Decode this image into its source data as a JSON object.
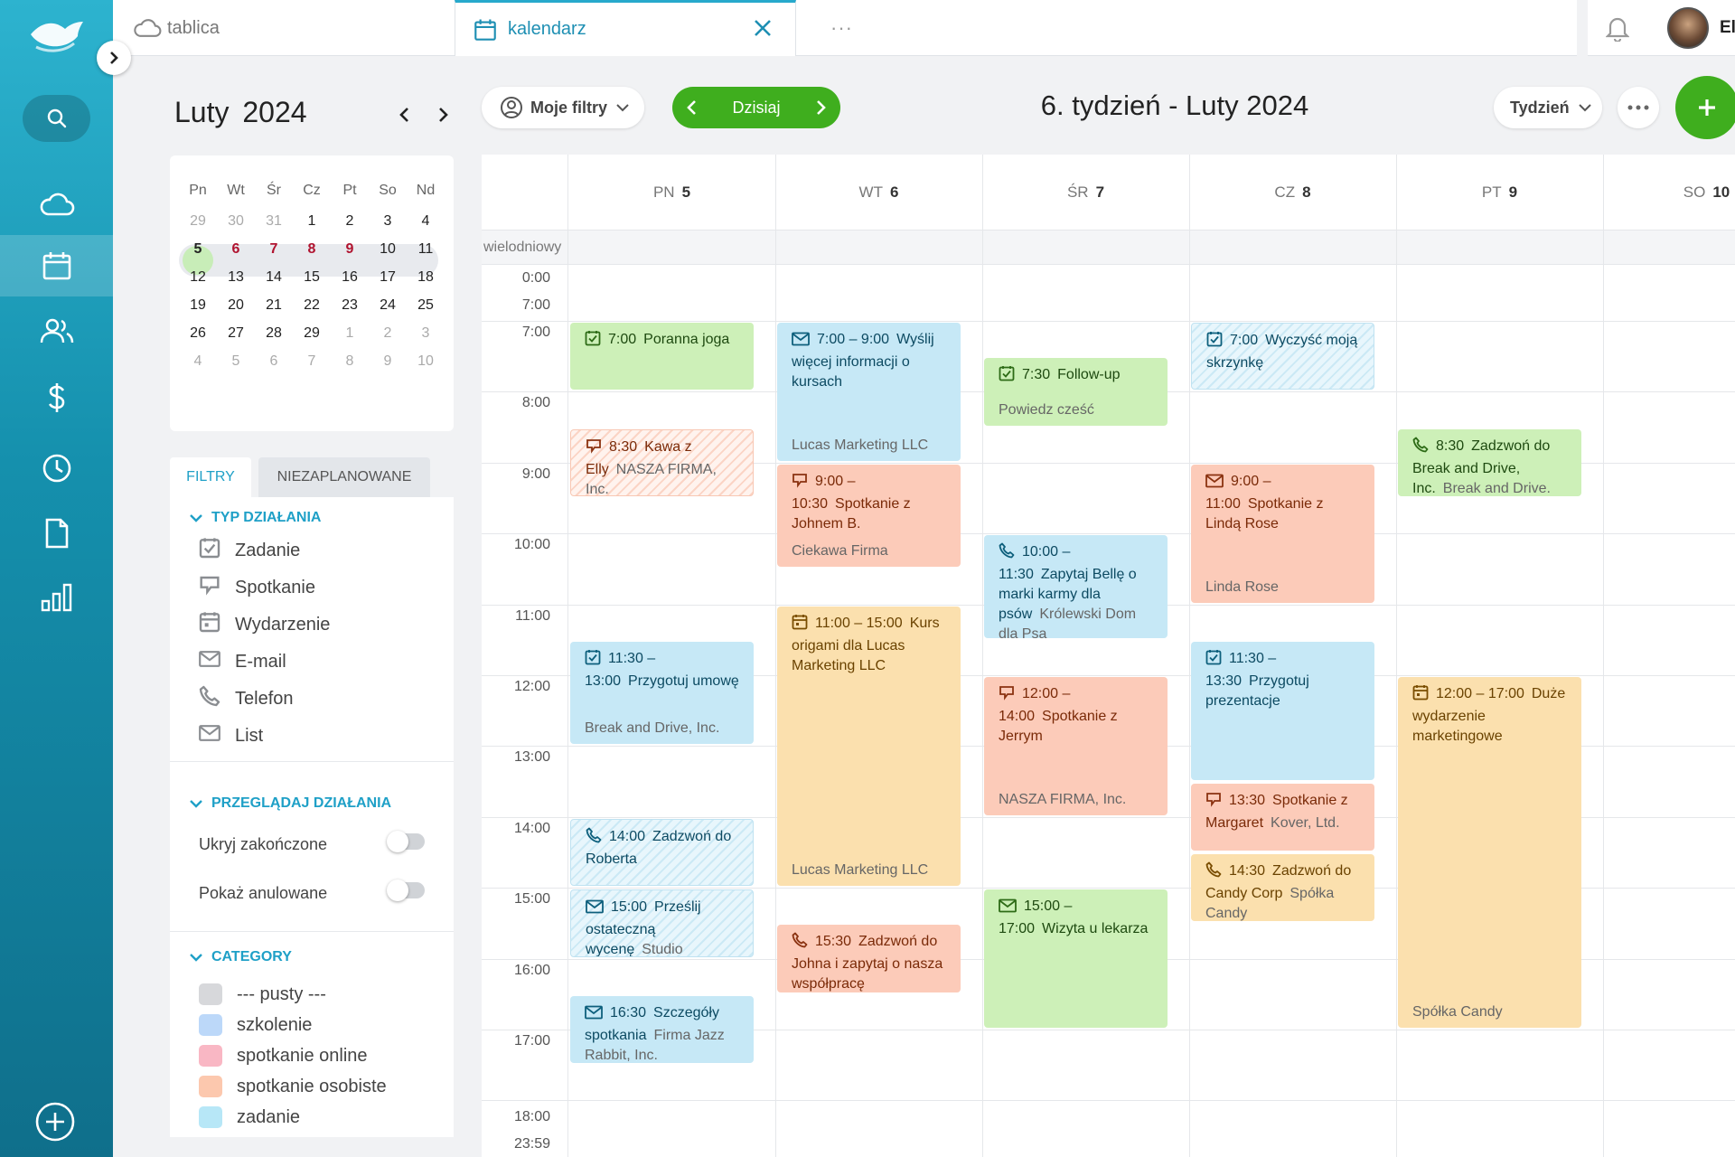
{
  "tabs": {
    "tab1": "tablica",
    "tab2": "kalendarz",
    "more": "···"
  },
  "user": {
    "name": "Ell"
  },
  "mini": {
    "month": "Luty",
    "year": "2024",
    "days": [
      "Pn",
      "Wt",
      "Śr",
      "Cz",
      "Pt",
      "So",
      "Nd"
    ],
    "rows": [
      [
        "29",
        "30",
        "31",
        "1",
        "2",
        "3",
        "4"
      ],
      [
        "5",
        "6",
        "7",
        "8",
        "9",
        "10",
        "11"
      ],
      [
        "12",
        "13",
        "14",
        "15",
        "16",
        "17",
        "18"
      ],
      [
        "19",
        "20",
        "21",
        "22",
        "23",
        "24",
        "25"
      ],
      [
        "26",
        "27",
        "28",
        "29",
        "1",
        "2",
        "3"
      ],
      [
        "4",
        "5",
        "6",
        "7",
        "8",
        "9",
        "10"
      ]
    ]
  },
  "filters": {
    "tab_filters": "FILTRY",
    "tab_unscheduled": "NIEZAPLANOWANE",
    "type_title": "TYP DZIAŁANIA",
    "types": [
      "Zadanie",
      "Spotkanie",
      "Wydarzenie",
      "E-mail",
      "Telefon",
      "List"
    ],
    "browse_title": "PRZEGLĄDAJ DZIAŁANIA",
    "hide_completed": "Ukryj zakończone",
    "show_cancelled": "Pokaż anulowane",
    "category_title": "CATEGORY",
    "categories": [
      "--- pusty ---",
      "szkolenie",
      "spotkanie online",
      "spotkanie osobiste",
      "zadanie"
    ],
    "category_colors": [
      "#d7d8db",
      "#bcd8f9",
      "#f9b7c4",
      "#fcc8ae",
      "#b7e7f7"
    ]
  },
  "toolbar": {
    "my_filters": "Moje filtry",
    "today": "Dzisiaj",
    "week_title": "6. tydzień - Luty 2024",
    "view": "Tydzień"
  },
  "grid": {
    "allday": "wielodniowy",
    "days": [
      {
        "name": "PN",
        "num": "5"
      },
      {
        "name": "WT",
        "num": "6"
      },
      {
        "name": "ŚR",
        "num": "7"
      },
      {
        "name": "CZ",
        "num": "8"
      },
      {
        "name": "PT",
        "num": "9"
      },
      {
        "name": "SO",
        "num": "10"
      }
    ],
    "early": [
      "0:00",
      "7:00"
    ],
    "hours": [
      "7:00",
      "8:00",
      "9:00",
      "10:00",
      "11:00",
      "12:00",
      "13:00",
      "14:00",
      "15:00",
      "16:00",
      "17:00"
    ],
    "late": [
      "18:00",
      "23:59"
    ]
  },
  "events": [
    {
      "day": 0,
      "start": 7.0,
      "end": 8.0,
      "color": "green",
      "icon": "task",
      "time": "7:00",
      "title": "Poranna joga",
      "sub": "",
      "bottom": ""
    },
    {
      "day": 0,
      "start": 8.5,
      "end": 9.5,
      "color": "orange-hatch",
      "icon": "meeting",
      "time": "8:30",
      "title": "Kawa z Elly",
      "sub": "NASZA FIRMA, Inc.",
      "bottom": ""
    },
    {
      "day": 0,
      "start": 11.5,
      "end": 13.0,
      "color": "blue",
      "icon": "task",
      "time": "11:30 – 13:00",
      "title": "Przygotuj umowę",
      "sub": "",
      "bottom": "Break and Drive, Inc."
    },
    {
      "day": 0,
      "start": 14.0,
      "end": 15.0,
      "color": "blue-hatch",
      "icon": "phone",
      "time": "14:00",
      "title": "Zadzwoń do Roberta",
      "sub": "",
      "bottom": ""
    },
    {
      "day": 0,
      "start": 15.0,
      "end": 16.0,
      "color": "blue-hatch",
      "icon": "email",
      "time": "15:00",
      "title": "Prześlij ostateczną wycenę",
      "sub": "Studio",
      "bottom": ""
    },
    {
      "day": 0,
      "start": 16.5,
      "end": 17.5,
      "color": "blue",
      "icon": "email",
      "time": "16:30",
      "title": "Szczegóły spotkania",
      "sub": "Firma Jazz Rabbit, Inc.",
      "bottom": ""
    },
    {
      "day": 1,
      "start": 7.0,
      "end": 9.0,
      "color": "blue",
      "icon": "email",
      "time": "7:00 – 9:00",
      "title": "Wyślij więcej informacji o kursach",
      "sub": "",
      "bottom": "Lucas Marketing LLC"
    },
    {
      "day": 1,
      "start": 9.0,
      "end": 10.5,
      "color": "orange",
      "icon": "meeting",
      "time": "9:00 – 10:30",
      "title": "Spotkanie z Johnem B.",
      "sub": "",
      "bottom": "Ciekawa Firma"
    },
    {
      "day": 1,
      "start": 11.0,
      "end": 15.0,
      "color": "yellow",
      "icon": "event",
      "time": "11:00 – 15:00",
      "title": "Kurs origami dla Lucas Marketing LLC",
      "sub": "",
      "bottom": "Lucas Marketing LLC"
    },
    {
      "day": 1,
      "start": 15.5,
      "end": 16.5,
      "color": "orange",
      "icon": "phone",
      "time": "15:30",
      "title": "Zadzwoń do Johna i zapytaj o nasza współpracę",
      "sub": "",
      "bottom": ""
    },
    {
      "day": 2,
      "start": 7.5,
      "end": 8.5,
      "color": "green",
      "icon": "task",
      "time": "7:30",
      "title": "Follow-up",
      "sub": "",
      "bottom": "Powiedz cześć"
    },
    {
      "day": 2,
      "start": 10.0,
      "end": 11.5,
      "color": "blue",
      "icon": "phone",
      "time": "10:00 – 11:30",
      "title": "Zapytaj Bellę o marki karmy dla psów",
      "sub": "Królewski Dom dla Psa",
      "bottom": ""
    },
    {
      "day": 2,
      "start": 12.0,
      "end": 14.0,
      "color": "orange",
      "icon": "meeting",
      "time": "12:00 – 14:00",
      "title": "Spotkanie z Jerrym",
      "sub": "",
      "bottom": "NASZA FIRMA, Inc."
    },
    {
      "day": 2,
      "start": 15.0,
      "end": 17.0,
      "color": "green",
      "icon": "email",
      "time": "15:00 – 17:00",
      "title": "Wizyta u lekarza",
      "sub": "",
      "bottom": ""
    },
    {
      "day": 3,
      "start": 7.0,
      "end": 8.0,
      "color": "blue-hatch",
      "icon": "task",
      "time": "7:00",
      "title": "Wyczyść moją skrzynkę",
      "sub": "",
      "bottom": ""
    },
    {
      "day": 3,
      "start": 9.0,
      "end": 11.0,
      "color": "orange",
      "icon": "email",
      "time": "9:00 – 11:00",
      "title": "Spotkanie z Lindą Rose",
      "sub": "",
      "bottom": "Linda Rose"
    },
    {
      "day": 3,
      "start": 11.5,
      "end": 13.5,
      "color": "blue",
      "icon": "task",
      "time": "11:30 – 13:30",
      "title": "Przygotuj prezentacje",
      "sub": "",
      "bottom": ""
    },
    {
      "day": 3,
      "start": 13.5,
      "end": 14.5,
      "color": "orange",
      "icon": "meeting",
      "time": "13:30",
      "title": "Spotkanie z Margaret",
      "sub": "Kover, Ltd.",
      "bottom": ""
    },
    {
      "day": 3,
      "start": 14.5,
      "end": 15.5,
      "color": "yellow",
      "icon": "phone",
      "time": "14:30",
      "title": "Zadzwoń do Candy Corp",
      "sub": "Spółka Candy",
      "bottom": ""
    },
    {
      "day": 4,
      "start": 8.5,
      "end": 9.5,
      "color": "green",
      "icon": "phone",
      "time": "8:30",
      "title": "Zadzwoń do Break and Drive, Inc.",
      "sub": "Break and Drive.",
      "bottom": ""
    },
    {
      "day": 4,
      "start": 12.0,
      "end": 17.0,
      "color": "yellow",
      "icon": "event",
      "time": "12:00 – 17:00",
      "title": "Duże wydarzenie marketingowe",
      "sub": "",
      "bottom": "Spółka Candy"
    }
  ]
}
